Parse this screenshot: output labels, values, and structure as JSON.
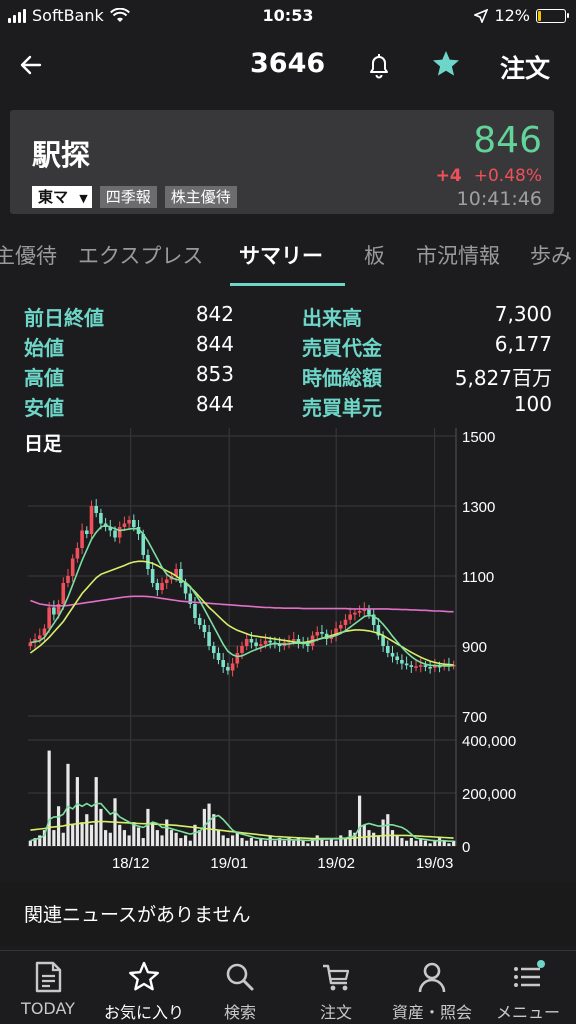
{
  "status_bar": {
    "carrier": "SoftBank",
    "time": "10:53",
    "battery": "12%",
    "battery_level": 0.12
  },
  "nav": {
    "code": "3646",
    "order_label": "注文"
  },
  "stock": {
    "name": "駅探",
    "price": "846",
    "change": "+4",
    "change_pct": "+0.48%",
    "time": "10:41:46",
    "market": "東マ",
    "tags": [
      "四季報",
      "株主優待"
    ]
  },
  "tabs": [
    "主優待",
    "エクスプレス",
    "サマリー",
    "板",
    "市況情報",
    "歩み"
  ],
  "active_tab": "サマリー",
  "stats": {
    "left": [
      {
        "label": "前日終値",
        "value": "842"
      },
      {
        "label": "始値",
        "value": "844"
      },
      {
        "label": "高値",
        "value": "853"
      },
      {
        "label": "安値",
        "value": "844"
      }
    ],
    "right": [
      {
        "label": "出来高",
        "value": "7,300"
      },
      {
        "label": "売買代金",
        "value": "6,177"
      },
      {
        "label": "時価総額",
        "value": "5,827百万"
      },
      {
        "label": "売買単元",
        "value": "100"
      }
    ]
  },
  "chart_data": {
    "type": "candlestick",
    "title": "日足",
    "price_axis": {
      "ticks": [
        "1500",
        "1300",
        "1100",
        "900",
        "700"
      ],
      "range": [
        700,
        1500
      ]
    },
    "volume_axis": {
      "ticks": [
        "400,000",
        "200,000",
        "0"
      ],
      "range": [
        0,
        400000
      ]
    },
    "x_labels": [
      "18/12",
      "19/01",
      "19/02",
      "19/03"
    ],
    "closes": [
      910,
      920,
      930,
      950,
      1010,
      990,
      1020,
      1080,
      1100,
      1150,
      1180,
      1230,
      1220,
      1300,
      1280,
      1250,
      1240,
      1230,
      1210,
      1240,
      1250,
      1260,
      1240,
      1220,
      1160,
      1120,
      1080,
      1060,
      1080,
      1090,
      1100,
      1120,
      1080,
      1050,
      1020,
      980,
      960,
      940,
      900,
      880,
      860,
      840,
      830,
      850,
      880,
      900,
      920,
      910,
      900,
      905,
      915,
      910,
      905,
      900,
      910,
      915,
      920,
      910,
      905,
      900,
      930,
      940,
      935,
      920,
      930,
      950,
      960,
      975,
      990,
      995,
      1000,
      1005,
      990,
      960,
      930,
      900,
      880,
      870,
      860,
      850,
      845,
      840,
      842,
      845,
      840,
      838,
      843,
      842,
      846,
      845,
      846
    ],
    "ma_short": [
      910,
      912,
      915,
      925,
      945,
      965,
      985,
      1010,
      1040,
      1075,
      1110,
      1145,
      1175,
      1205,
      1225,
      1240,
      1245,
      1240,
      1235,
      1230,
      1232,
      1234,
      1236,
      1234,
      1220,
      1200,
      1175,
      1150,
      1125,
      1105,
      1095,
      1090,
      1088,
      1082,
      1070,
      1050,
      1030,
      1005,
      980,
      955,
      930,
      905,
      885,
      875,
      870,
      872,
      878,
      885,
      890,
      895,
      900,
      905,
      907,
      906,
      905,
      906,
      908,
      908,
      908,
      907,
      912,
      918,
      922,
      924,
      926,
      930,
      936,
      944,
      954,
      964,
      974,
      984,
      988,
      985,
      976,
      962,
      946,
      928,
      912,
      896,
      882,
      870,
      860,
      853,
      848,
      845,
      844,
      844,
      843,
      843,
      844
    ],
    "ma_mid": [
      880,
      890,
      900,
      912,
      925,
      940,
      955,
      970,
      990,
      1010,
      1030,
      1050,
      1065,
      1080,
      1095,
      1105,
      1110,
      1115,
      1120,
      1125,
      1130,
      1136,
      1140,
      1142,
      1142,
      1140,
      1136,
      1130,
      1122,
      1115,
      1108,
      1100,
      1090,
      1080,
      1068,
      1055,
      1040,
      1025,
      1010,
      998,
      985,
      972,
      960,
      952,
      945,
      940,
      935,
      930,
      928,
      926,
      924,
      922,
      920,
      918,
      916,
      914,
      912,
      910,
      910,
      912,
      915,
      918,
      922,
      926,
      930,
      934,
      938,
      942,
      944,
      946,
      946,
      945,
      943,
      940,
      936,
      930,
      922,
      914,
      906,
      898,
      890,
      882,
      875,
      868,
      862,
      857,
      853,
      850,
      848,
      847,
      846
    ],
    "ma_long": [
      1030,
      1025,
      1020,
      1018,
      1016,
      1015,
      1015,
      1015,
      1016,
      1018,
      1020,
      1022,
      1024,
      1026,
      1028,
      1030,
      1032,
      1034,
      1036,
      1038,
      1040,
      1041,
      1042,
      1042,
      1042,
      1041,
      1040,
      1038,
      1036,
      1034,
      1032,
      1030,
      1028,
      1027,
      1026,
      1025,
      1024,
      1023,
      1022,
      1021,
      1020,
      1019,
      1018,
      1017,
      1016,
      1015,
      1014,
      1013,
      1012,
      1011,
      1010,
      1010,
      1009,
      1009,
      1008,
      1008,
      1008,
      1008,
      1007,
      1007,
      1007,
      1007,
      1007,
      1007,
      1007,
      1007,
      1007,
      1007,
      1006,
      1006,
      1006,
      1006,
      1006,
      1006,
      1006,
      1006,
      1006,
      1005,
      1005,
      1004,
      1004,
      1003,
      1003,
      1002,
      1002,
      1001,
      1000,
      1000,
      999,
      998,
      998
    ],
    "volumes": [
      20000,
      30000,
      40000,
      60000,
      360000,
      60000,
      150000,
      50000,
      310000,
      80000,
      260000,
      90000,
      120000,
      80000,
      260000,
      140000,
      60000,
      50000,
      180000,
      80000,
      60000,
      40000,
      90000,
      70000,
      30000,
      140000,
      90000,
      60000,
      40000,
      100000,
      60000,
      50000,
      30000,
      40000,
      20000,
      80000,
      60000,
      140000,
      160000,
      120000,
      60000,
      40000,
      30000,
      40000,
      50000,
      30000,
      20000,
      30000,
      20000,
      30000,
      20000,
      40000,
      20000,
      30000,
      20000,
      30000,
      20000,
      30000,
      20000,
      10000,
      30000,
      40000,
      30000,
      20000,
      30000,
      20000,
      40000,
      30000,
      60000,
      50000,
      190000,
      80000,
      60000,
      50000,
      40000,
      100000,
      120000,
      60000,
      40000,
      30000,
      20000,
      30000,
      20000,
      30000,
      20000,
      10000,
      20000,
      30000,
      20000,
      10000,
      20000
    ],
    "vol_ma_short": [
      20000,
      25000,
      30000,
      40000,
      100000,
      110000,
      110000,
      120000,
      150000,
      140000,
      160000,
      150000,
      160000,
      150000,
      160000,
      160000,
      140000,
      120000,
      130000,
      110000,
      100000,
      90000,
      80000,
      75000,
      70000,
      80000,
      90000,
      85000,
      70000,
      70000,
      65000,
      60000,
      55000,
      50000,
      45000,
      50000,
      55000,
      75000,
      95000,
      110000,
      115000,
      100000,
      80000,
      60000,
      50000,
      45000,
      40000,
      35000,
      30000,
      28000,
      26000,
      25000,
      25000,
      25000,
      24000,
      24000,
      23000,
      23000,
      22000,
      21000,
      22000,
      24000,
      26000,
      26000,
      27000,
      27000,
      28000,
      30000,
      34000,
      38000,
      70000,
      80000,
      85000,
      80000,
      75000,
      75000,
      80000,
      80000,
      75000,
      70000,
      60000,
      45000,
      30000,
      27000,
      25000,
      22000,
      20000,
      20000,
      20000,
      18000,
      18000
    ],
    "vol_ma_long": [
      60000,
      62000,
      64000,
      66000,
      70000,
      72000,
      74000,
      76000,
      80000,
      82000,
      84000,
      86000,
      88000,
      90000,
      92000,
      92000,
      92000,
      91000,
      90000,
      89000,
      88000,
      87000,
      86000,
      85000,
      84000,
      84000,
      83000,
      82000,
      81000,
      80000,
      79000,
      78000,
      76000,
      74000,
      72000,
      70000,
      68000,
      66000,
      64000,
      62000,
      60000,
      58000,
      56000,
      54000,
      52000,
      50000,
      48000,
      46000,
      44000,
      42000,
      40000,
      38000,
      36000,
      35000,
      34000,
      33000,
      32000,
      31000,
      30000,
      29000,
      28000,
      28000,
      28000,
      28000,
      28000,
      28000,
      28000,
      28000,
      29000,
      30000,
      32000,
      34000,
      36000,
      37000,
      38000,
      39000,
      40000,
      40000,
      40000,
      40000,
      40000,
      39000,
      38000,
      37000,
      36000,
      35000,
      34000,
      33000,
      32000,
      31000,
      30000
    ]
  },
  "news": {
    "text": "関連ニュースがありません"
  },
  "tabbar": [
    {
      "label": "TODAY",
      "icon": "today-icon"
    },
    {
      "label": "お気に入り",
      "icon": "star-icon"
    },
    {
      "label": "検索",
      "icon": "search-icon"
    },
    {
      "label": "注文",
      "icon": "cart-icon"
    },
    {
      "label": "資産・照会",
      "icon": "person-icon"
    },
    {
      "label": "メニュー",
      "icon": "menu-icon"
    }
  ],
  "colors": {
    "accent": "#6ed6c8",
    "up": "#f0505a",
    "down": "#7de0c8",
    "price": "#62d49a",
    "ma_short": "#7de0a0",
    "ma_mid": "#d6f06a",
    "ma_long": "#e070c8",
    "volume": "#e8e8e8"
  }
}
